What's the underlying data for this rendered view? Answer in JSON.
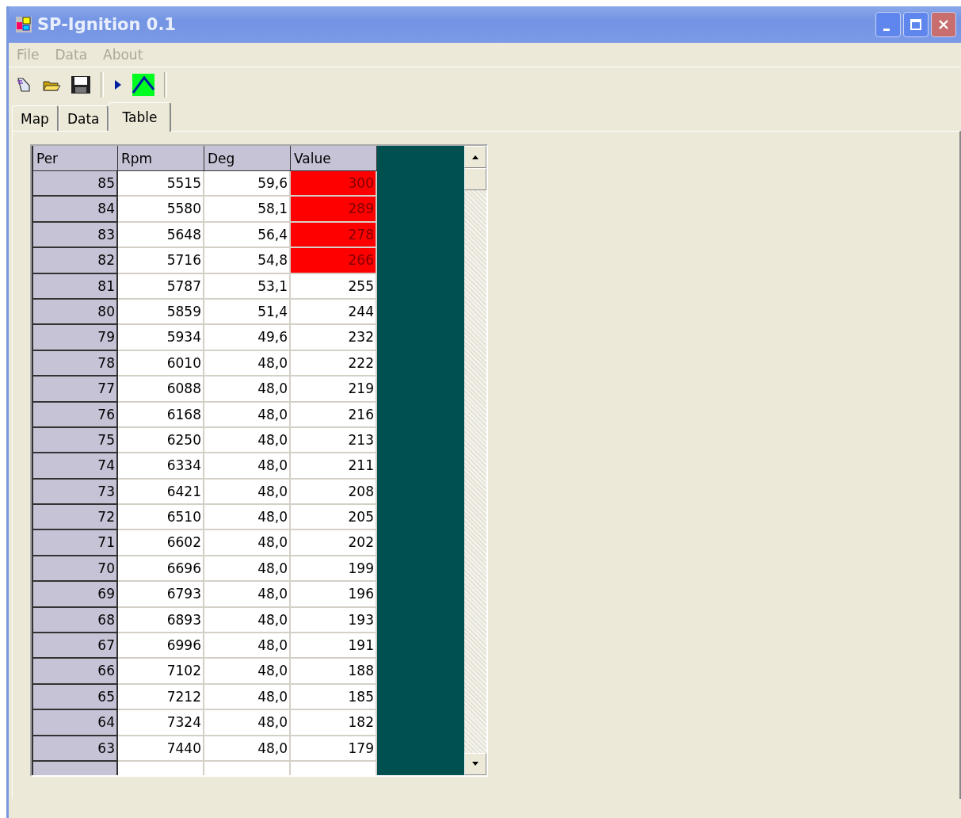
{
  "window": {
    "title": "SP-Ignition 0.1"
  },
  "menu": [
    "File",
    "Data",
    "About"
  ],
  "tabs": [
    {
      "label": "Map",
      "selected": false
    },
    {
      "label": "Data",
      "selected": false
    },
    {
      "label": "Table",
      "selected": true
    }
  ],
  "table": {
    "columns": [
      "Per",
      "Rpm",
      "Deg",
      "Value"
    ],
    "rows": [
      {
        "per": "85",
        "rpm": "5515",
        "deg": "59,6",
        "value": "300",
        "highlighted": true
      },
      {
        "per": "84",
        "rpm": "5580",
        "deg": "58,1",
        "value": "289",
        "highlighted": true
      },
      {
        "per": "83",
        "rpm": "5648",
        "deg": "56,4",
        "value": "278",
        "highlighted": true
      },
      {
        "per": "82",
        "rpm": "5716",
        "deg": "54,8",
        "value": "266",
        "highlighted": true
      },
      {
        "per": "81",
        "rpm": "5787",
        "deg": "53,1",
        "value": "255",
        "highlighted": false
      },
      {
        "per": "80",
        "rpm": "5859",
        "deg": "51,4",
        "value": "244",
        "highlighted": false
      },
      {
        "per": "79",
        "rpm": "5934",
        "deg": "49,6",
        "value": "232",
        "highlighted": false
      },
      {
        "per": "78",
        "rpm": "6010",
        "deg": "48,0",
        "value": "222",
        "highlighted": false
      },
      {
        "per": "77",
        "rpm": "6088",
        "deg": "48,0",
        "value": "219",
        "highlighted": false
      },
      {
        "per": "76",
        "rpm": "6168",
        "deg": "48,0",
        "value": "216",
        "highlighted": false
      },
      {
        "per": "75",
        "rpm": "6250",
        "deg": "48,0",
        "value": "213",
        "highlighted": false
      },
      {
        "per": "74",
        "rpm": "6334",
        "deg": "48,0",
        "value": "211",
        "highlighted": false
      },
      {
        "per": "73",
        "rpm": "6421",
        "deg": "48,0",
        "value": "208",
        "highlighted": false
      },
      {
        "per": "72",
        "rpm": "6510",
        "deg": "48,0",
        "value": "205",
        "highlighted": false
      },
      {
        "per": "71",
        "rpm": "6602",
        "deg": "48,0",
        "value": "202",
        "highlighted": false
      },
      {
        "per": "70",
        "rpm": "6696",
        "deg": "48,0",
        "value": "199",
        "highlighted": false
      },
      {
        "per": "69",
        "rpm": "6793",
        "deg": "48,0",
        "value": "196",
        "highlighted": false
      },
      {
        "per": "68",
        "rpm": "6893",
        "deg": "48,0",
        "value": "193",
        "highlighted": false
      },
      {
        "per": "67",
        "rpm": "6996",
        "deg": "48,0",
        "value": "191",
        "highlighted": false
      },
      {
        "per": "66",
        "rpm": "7102",
        "deg": "48,0",
        "value": "188",
        "highlighted": false
      },
      {
        "per": "65",
        "rpm": "7212",
        "deg": "48,0",
        "value": "185",
        "highlighted": false
      },
      {
        "per": "64",
        "rpm": "7324",
        "deg": "48,0",
        "value": "182",
        "highlighted": false
      },
      {
        "per": "63",
        "rpm": "7440",
        "deg": "48,0",
        "value": "179",
        "highlighted": false
      }
    ]
  }
}
